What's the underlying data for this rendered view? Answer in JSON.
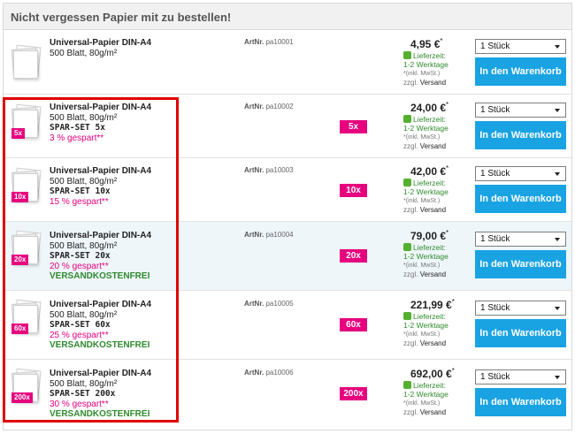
{
  "header": {
    "title": "Nicht vergessen Papier mit zu bestellen!"
  },
  "rows": [
    {
      "name": "Universal-Papier DIN-A4",
      "spec": "500 Blatt, 80g/m²",
      "set": "",
      "saved": "",
      "free": "",
      "tag": "",
      "artnr_label": "ArtNr.",
      "artnr": "pa10001",
      "qty_badge": "",
      "price": "4,95 €",
      "price_mark": "*",
      "avail_label": "Lieferzeit:",
      "avail_days": "1-2 Werktage",
      "vat": "*(inkl. MwSt.)",
      "ship_prefix": "zzgl.",
      "ship_link": "Versand",
      "select_value": "1 Stück",
      "cart_label": "In den Warenkorb"
    },
    {
      "name": "Universal-Papier DIN-A4",
      "spec": "500 Blatt, 80g/m²",
      "set": "SPAR-SET 5x",
      "saved": "3 % gespart**",
      "free": "",
      "tag": "5x",
      "artnr_label": "ArtNr.",
      "artnr": "pa10002",
      "qty_badge": "5x",
      "price": "24,00 €",
      "price_mark": "*",
      "avail_label": "Lieferzeit:",
      "avail_days": "1-2 Werktage",
      "vat": "*(inkl. MwSt.)",
      "ship_prefix": "zzgl.",
      "ship_link": "Versand",
      "select_value": "1 Stück",
      "cart_label": "In den Warenkorb"
    },
    {
      "name": "Universal-Papier DIN-A4",
      "spec": "500 Blatt, 80g/m²",
      "set": "SPAR-SET 10x",
      "saved": "15 % gespart**",
      "free": "",
      "tag": "10x",
      "artnr_label": "ArtNr.",
      "artnr": "pa10003",
      "qty_badge": "10x",
      "price": "42,00 €",
      "price_mark": "*",
      "avail_label": "Lieferzeit:",
      "avail_days": "1-2 Werktage",
      "vat": "*(inkl. MwSt.)",
      "ship_prefix": "zzgl.",
      "ship_link": "Versand",
      "select_value": "1 Stück",
      "cart_label": "In den Warenkorb"
    },
    {
      "name": "Universal-Papier DIN-A4",
      "spec": "500 Blatt, 80g/m²",
      "set": "SPAR-SET 20x",
      "saved": "20 % gespart**",
      "free": "VERSANDKOSTENFREI",
      "tag": "20x",
      "artnr_label": "ArtNr.",
      "artnr": "pa10004",
      "qty_badge": "20x",
      "price": "79,00 €",
      "price_mark": "*",
      "avail_label": "Lieferzeit:",
      "avail_days": "1-2 Werktage",
      "vat": "*(inkl. MwSt.)",
      "ship_prefix": "zzgl.",
      "ship_link": "Versand",
      "select_value": "1 Stück",
      "cart_label": "In den Warenkorb"
    },
    {
      "name": "Universal-Papier DIN-A4",
      "spec": "500 Blatt, 80g/m²",
      "set": "SPAR-SET 60x",
      "saved": "25 % gespart**",
      "free": "VERSANDKOSTENFREI",
      "tag": "60x",
      "artnr_label": "ArtNr.",
      "artnr": "pa10005",
      "qty_badge": "60x",
      "price": "221,99 €",
      "price_mark": "*",
      "avail_label": "Lieferzeit:",
      "avail_days": "1-2 Werktage",
      "vat": "*(inkl. MwSt.)",
      "ship_prefix": "zzgl.",
      "ship_link": "Versand",
      "select_value": "1 Stück",
      "cart_label": "In den Warenkorb"
    },
    {
      "name": "Universal-Papier DIN-A4",
      "spec": "500 Blatt, 80g/m²",
      "set": "SPAR-SET 200x",
      "saved": "30 % gespart**",
      "free": "VERSANDKOSTENFREI",
      "tag": "200x",
      "artnr_label": "ArtNr.",
      "artnr": "pa10006",
      "qty_badge": "200x",
      "price": "692,00 €",
      "price_mark": "*",
      "avail_label": "Lieferzeit:",
      "avail_days": "1-2 Werktage",
      "vat": "*(inkl. MwSt.)",
      "ship_prefix": "zzgl.",
      "ship_link": "Versand",
      "select_value": "1 Stück",
      "cart_label": "In den Warenkorb"
    }
  ],
  "colors": {
    "accent_pink": "#e6007e",
    "button_blue": "#1aa3e3",
    "stock_green": "#55b030",
    "highlight_frame": "#e00000"
  },
  "icons": {
    "product": "paper-stack-icon",
    "availability": "availability-square-icon",
    "dropdown": "chevron-down-icon"
  }
}
